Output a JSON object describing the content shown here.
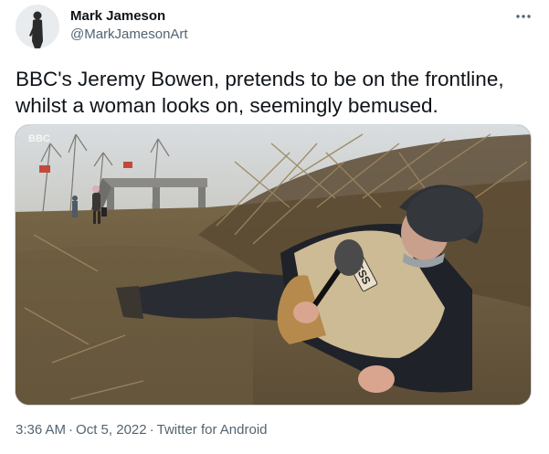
{
  "author": {
    "display_name": "Mark Jameson",
    "handle": "@MarkJamesonArt",
    "avatar_icon": "silhouette-figure-avatar"
  },
  "tweet": {
    "text_lines": [
      "BBC's Jeremy Bowen, pretends to be on the frontline,",
      "whilst a woman looks on, seemingly bemused."
    ],
    "media": {
      "watermark": "BBC",
      "vest_text": "PRESS"
    },
    "time": "3:36 AM",
    "date": "Oct 5, 2022",
    "separator": "·",
    "source": "Twitter for Android"
  },
  "icons": {
    "more": "more-options-icon"
  },
  "colors": {
    "text_primary": "#0f1419",
    "text_secondary": "#536471",
    "border": "#cfd9de"
  }
}
